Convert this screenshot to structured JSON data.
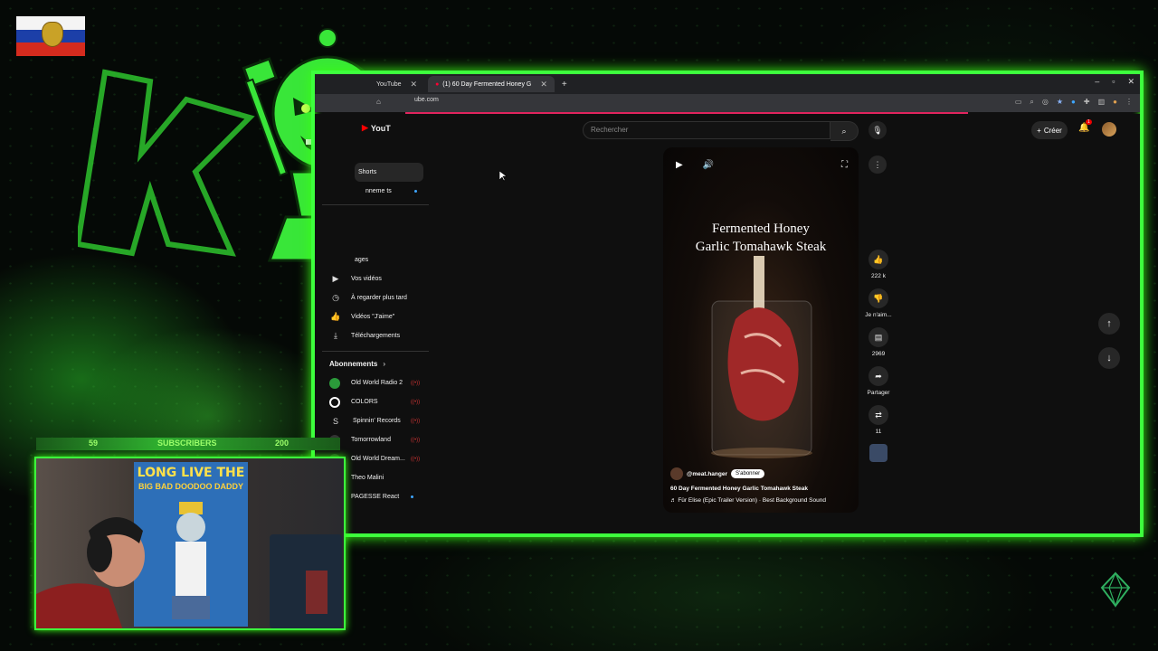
{
  "browser": {
    "tabs": [
      {
        "label": "YouTube",
        "active": false
      },
      {
        "label": "(1) 60 Day Fermented Honey G",
        "active": true
      }
    ],
    "url": "ube.com"
  },
  "youtube": {
    "logo_text": "YouT",
    "search_placeholder": "Rechercher",
    "create_label": "Créer",
    "notification_count": "1"
  },
  "sidebar": {
    "top_items": [
      {
        "label": "Shorts",
        "icon": "shorts-icon",
        "active": true
      },
      {
        "label": "nneme  ts",
        "icon": "subscriptions-icon",
        "dot": true
      }
    ],
    "you_items": [
      {
        "label": "ages",
        "icon": "history-icon"
      },
      {
        "label": "Vos vidéos",
        "icon": "play-square-icon"
      },
      {
        "label": "À regarder plus tard",
        "icon": "clock-icon"
      },
      {
        "label": "Vidéos \"J'aime\"",
        "icon": "thumb-up-icon"
      },
      {
        "label": "Téléchargements",
        "icon": "download-icon"
      }
    ],
    "subscriptions_heading": "Abonnements",
    "subscriptions": [
      {
        "label": "Old World Radio 2",
        "color": "#2b9a3a",
        "live": true
      },
      {
        "label": "COLORS",
        "color": "#ffffff",
        "live": true
      },
      {
        "label": "Spinnin' Records",
        "color": "#222222",
        "live": true
      },
      {
        "label": "Tomorrowland",
        "color": "#333333",
        "live": true
      },
      {
        "label": "Old World Dream...",
        "color": "#1e3a1e",
        "live": true
      },
      {
        "label": "Theo Malini",
        "color": "#444444",
        "live": false
      },
      {
        "label": "PAGESSE React",
        "color": "#555555",
        "new": true
      }
    ]
  },
  "short": {
    "overlay_title_line1": "Fermented Honey",
    "overlay_title_line2": "Garlic Tomahawk Steak",
    "channel": "@meat.hanger",
    "subscribe_label": "S'abonner",
    "title": "60 Day Fermented Honey Garlic Tomahawk Steak",
    "sound": "Für Elise (Epic Trailer Version) · Best Background Sound"
  },
  "actions": {
    "likes": "222 k",
    "dislike_label": "Je n'aim...",
    "comments": "2969",
    "share_label": "Partager",
    "remix_count": "11"
  },
  "stream": {
    "subs_current": "59",
    "subs_label": "SUBSCRIBERS",
    "subs_goal": "200",
    "poster_line1": "LONG LIVE THE",
    "poster_line2": "BIG BAD DOODOO DADDY"
  },
  "colors": {
    "neon": "#3dff3d",
    "yt_bg": "#0f0f0f",
    "progress": "#e0245e"
  }
}
